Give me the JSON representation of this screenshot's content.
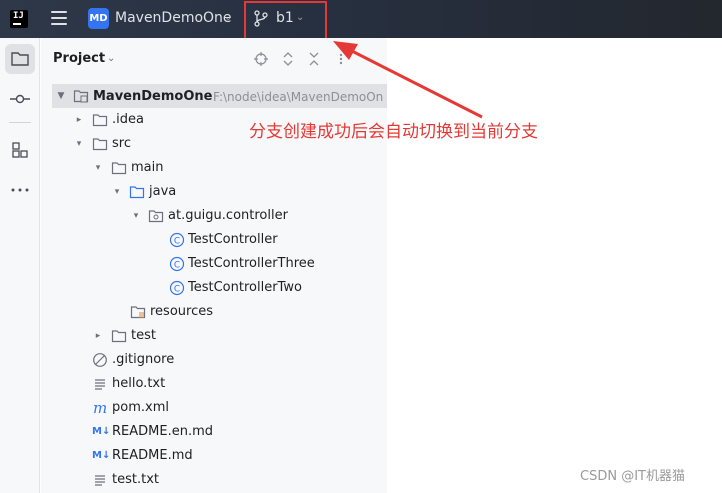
{
  "titlebar": {
    "logo_text": "IJ",
    "project_badge": "MD",
    "project_name": "MavenDemoOne",
    "branch_name": "b1",
    "icons": [
      "hamburger-menu-icon",
      "branch-icon",
      "chevron-down-icon"
    ]
  },
  "toolstrip": {
    "icons": [
      "folder-icon",
      "commit-icon",
      "structure-icon",
      "more-icon"
    ]
  },
  "panel": {
    "title": "Project",
    "header_icons": [
      "locate-icon",
      "expand-all-icon",
      "collapse-all-icon",
      "options-icon"
    ]
  },
  "tree": [
    {
      "label": "MavenDemoOne",
      "path": "F:\\node\\idea\\MavenDemoOn",
      "icon": "module-folder-icon",
      "expanded": true,
      "selected": true
    },
    {
      "label": ".idea",
      "icon": "folder-icon",
      "expanded": false
    },
    {
      "label": "src",
      "icon": "folder-icon",
      "expanded": true
    },
    {
      "label": "main",
      "icon": "folder-icon",
      "expanded": true
    },
    {
      "label": "java",
      "icon": "source-folder-icon",
      "expanded": true
    },
    {
      "label": "at.guigu.controller",
      "icon": "package-icon",
      "expanded": true
    },
    {
      "label": "TestController",
      "icon": "class-icon"
    },
    {
      "label": "TestControllerThree",
      "icon": "class-icon"
    },
    {
      "label": "TestControllerTwo",
      "icon": "class-icon"
    },
    {
      "label": "resources",
      "icon": "resources-folder-icon"
    },
    {
      "label": "test",
      "icon": "folder-icon",
      "expanded": false
    },
    {
      "label": ".gitignore",
      "icon": "ignore-file-icon"
    },
    {
      "label": "hello.txt",
      "icon": "text-file-icon"
    },
    {
      "label": "pom.xml",
      "icon": "maven-icon"
    },
    {
      "label": "README.en.md",
      "icon": "markdown-icon",
      "icon_text": "M↓"
    },
    {
      "label": "README.md",
      "icon": "markdown-icon",
      "icon_text": "M↓"
    },
    {
      "label": "test.txt",
      "icon": "text-file-icon"
    }
  ],
  "annotation": {
    "text": "分支创建成功后会自动切换到当前分支",
    "color": "#e53935"
  },
  "watermark": "CSDN @IT机器猫",
  "colors": {
    "accent": "#3574f0",
    "titlebar": "#2b3240",
    "selection": "#dfe1e5",
    "highlight_red": "#e53935"
  }
}
